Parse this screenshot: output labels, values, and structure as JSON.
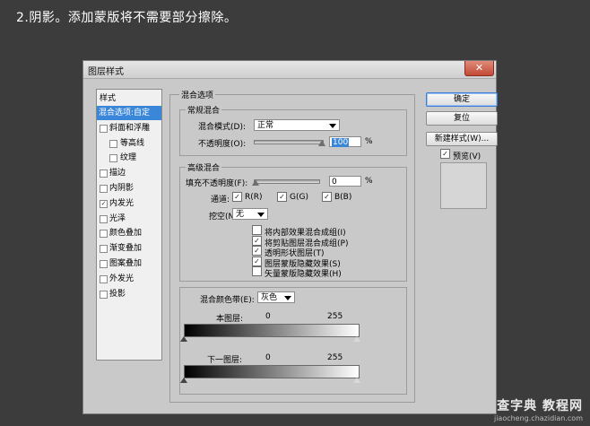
{
  "caption": "2.阴影。添加蒙版将不需要部分擦除。",
  "dialog": {
    "title": "图层样式",
    "close_glyph": "✕"
  },
  "style_list": {
    "header": "样式",
    "items": [
      {
        "label": "混合选项:自定",
        "checked": null,
        "selected": true
      },
      {
        "label": "斜面和浮雕",
        "checked": false
      },
      {
        "label": "等高线",
        "checked": false,
        "sub": true
      },
      {
        "label": "纹理",
        "checked": false,
        "sub": true
      },
      {
        "label": "描边",
        "checked": false
      },
      {
        "label": "内阴影",
        "checked": false
      },
      {
        "label": "内发光",
        "checked": true
      },
      {
        "label": "光泽",
        "checked": false
      },
      {
        "label": "颜色叠加",
        "checked": false
      },
      {
        "label": "渐变叠加",
        "checked": false
      },
      {
        "label": "图案叠加",
        "checked": false
      },
      {
        "label": "外发光",
        "checked": false
      },
      {
        "label": "投影",
        "checked": false
      }
    ]
  },
  "blend_options": {
    "title": "混合选项",
    "general": {
      "title": "常规混合",
      "mode_label": "混合模式(D):",
      "mode_value": "正常",
      "opacity_label": "不透明度(O):",
      "opacity_value": "100",
      "opacity_unit": "%",
      "opacity_level": 1.0
    },
    "advanced": {
      "title": "高级混合",
      "fill_label": "填充不透明度(F):",
      "fill_value": "0",
      "fill_unit": "%",
      "fill_level": 0.0,
      "channels_label": "通道:",
      "channels": [
        {
          "label": "R(R)",
          "checked": true
        },
        {
          "label": "G(G)",
          "checked": true
        },
        {
          "label": "B(B)",
          "checked": true
        }
      ],
      "knockout_label": "挖空(N):",
      "knockout_value": "无",
      "options": [
        {
          "label": "将内部效果混合成组(I)",
          "checked": false
        },
        {
          "label": "将剪贴图层混合成组(P)",
          "checked": true
        },
        {
          "label": "透明形状图层(T)",
          "checked": true
        },
        {
          "label": "图层蒙版隐藏效果(S)",
          "checked": true
        },
        {
          "label": "矢量蒙版隐藏效果(H)",
          "checked": false
        }
      ]
    },
    "blend_if": {
      "label": "混合颜色带(E):",
      "value": "灰色",
      "this_layer_label": "本图层:",
      "this_layer_min": "0",
      "this_layer_max": "255",
      "underlying_label": "下一图层:",
      "underlying_min": "0",
      "underlying_max": "255"
    }
  },
  "buttons": {
    "ok": "确定",
    "reset": "复位",
    "new_style": "新建样式(W)...",
    "preview_label": "预览(V)",
    "preview_checked": true
  },
  "watermark": {
    "line1": "查字典 教程网",
    "line2": "jiaocheng.chazidian.com"
  },
  "check_glyph": "✓"
}
